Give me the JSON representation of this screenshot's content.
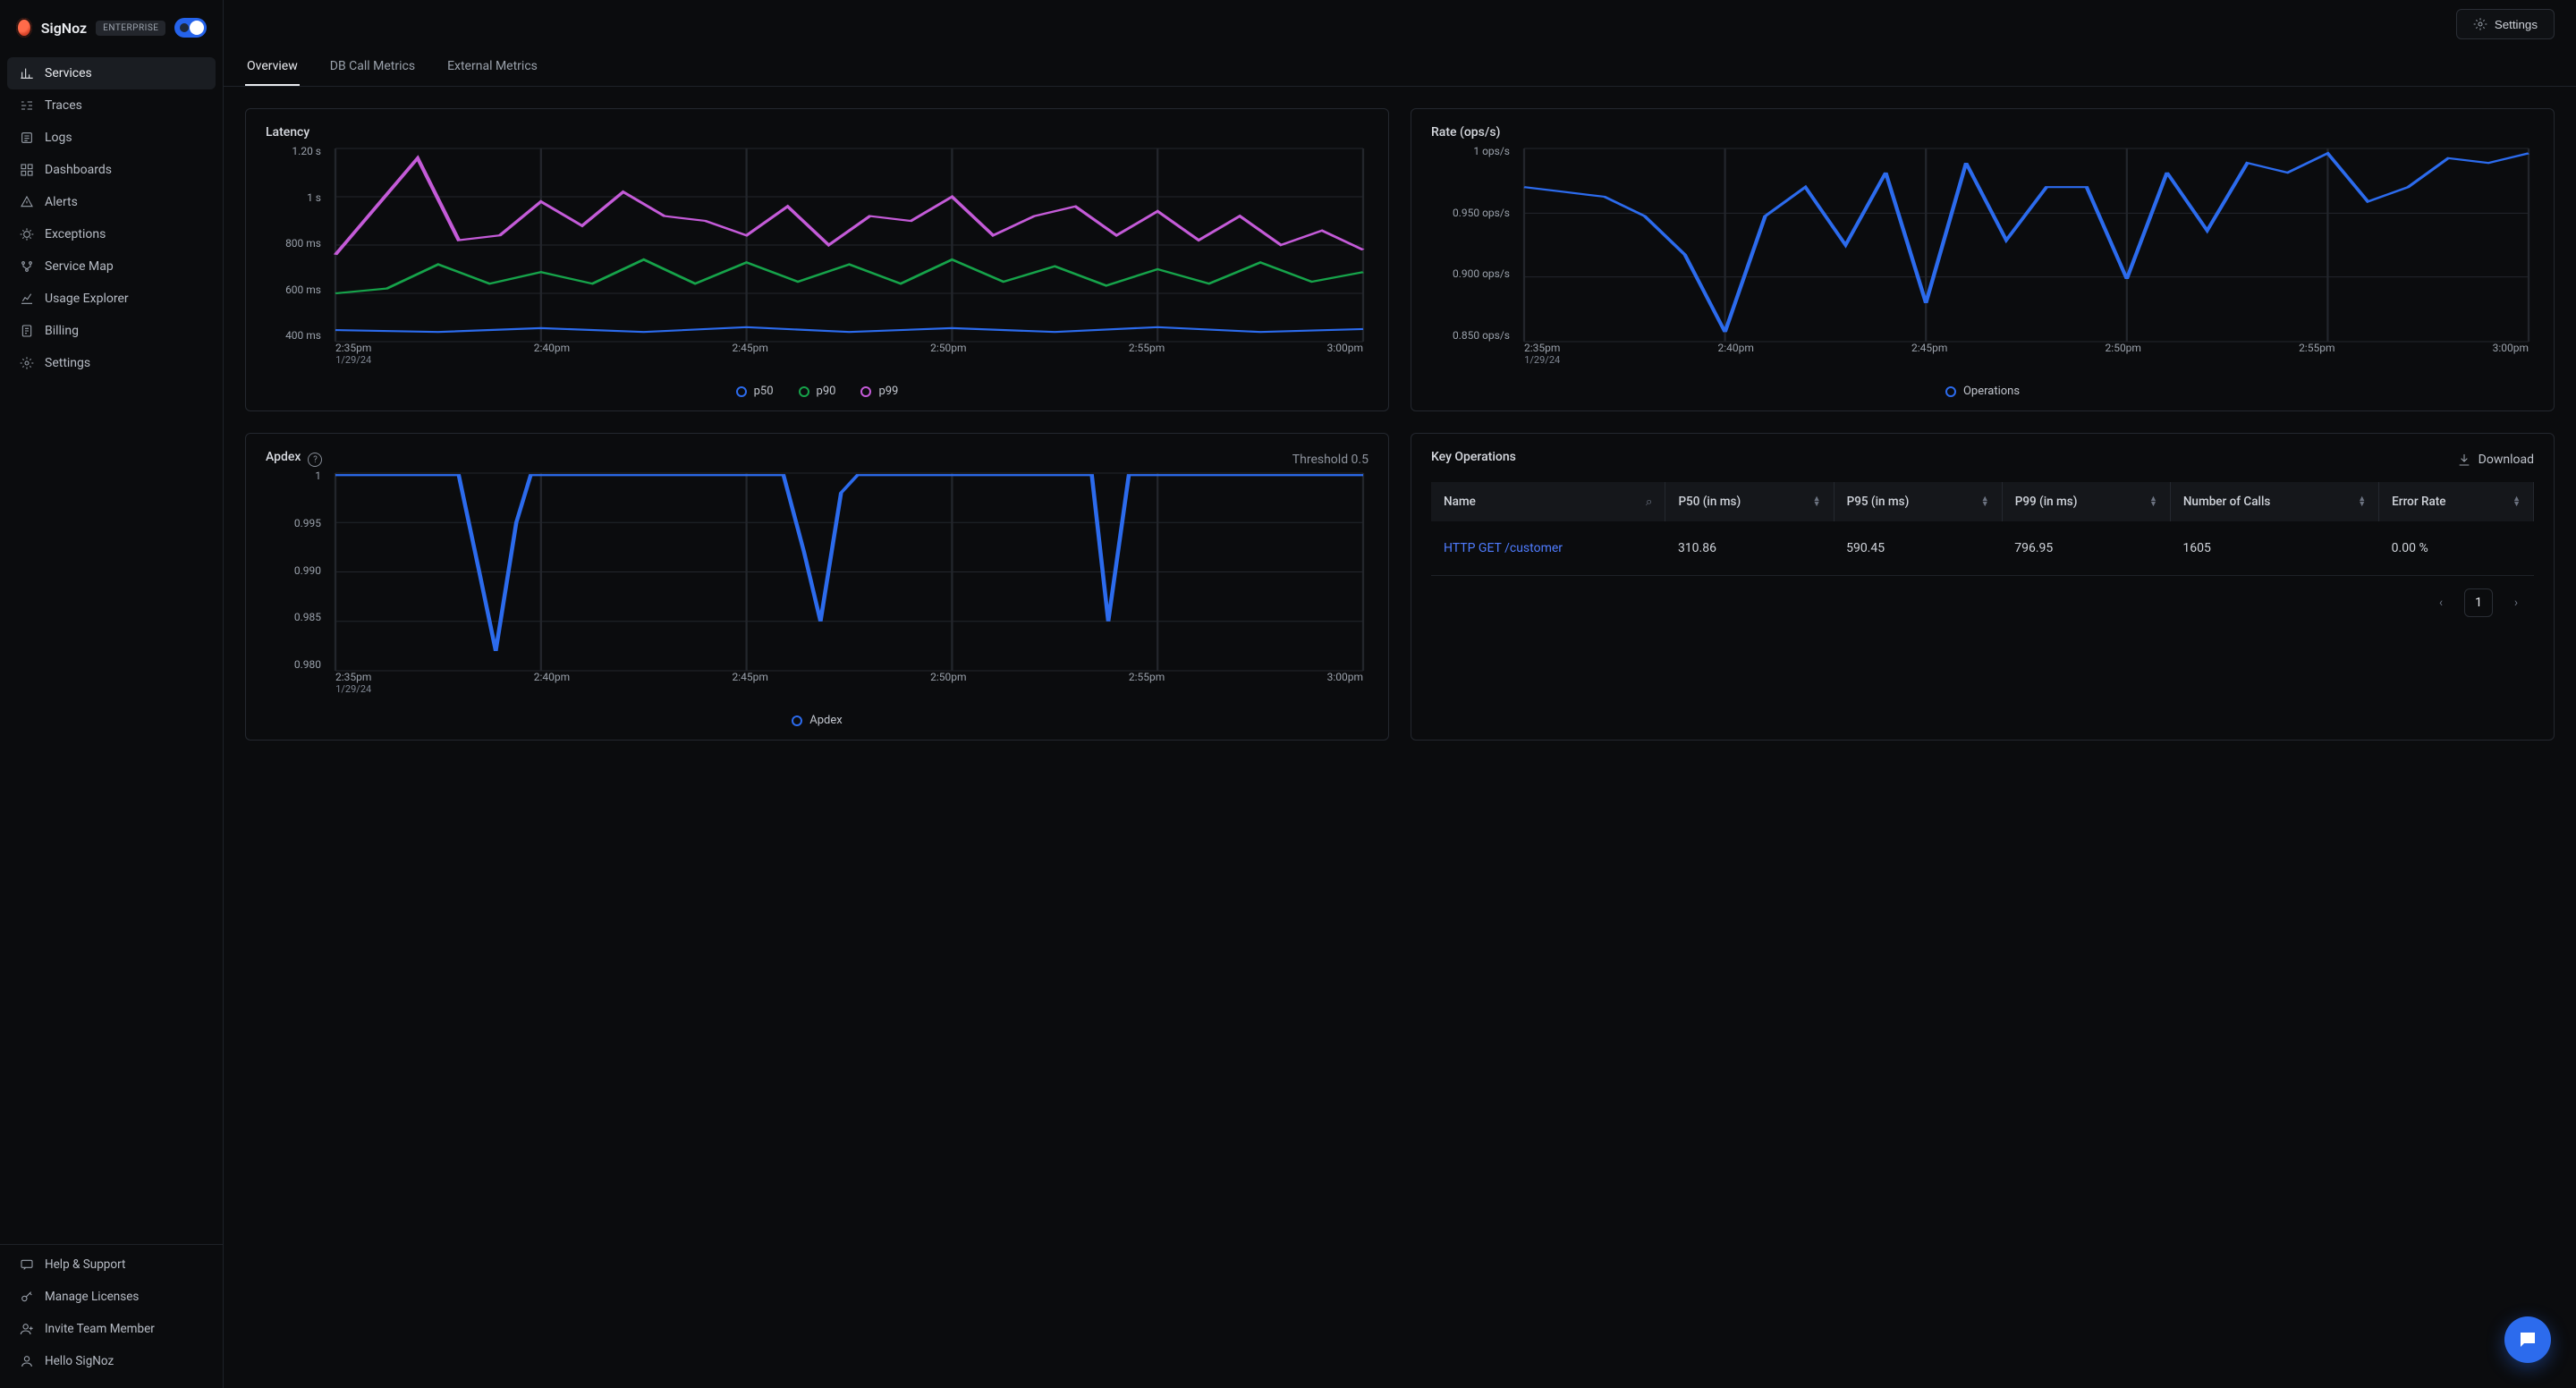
{
  "brand": {
    "name": "SigNoz",
    "tier": "ENTERPRISE"
  },
  "sidebar": {
    "items": [
      {
        "label": "Services"
      },
      {
        "label": "Traces"
      },
      {
        "label": "Logs"
      },
      {
        "label": "Dashboards"
      },
      {
        "label": "Alerts"
      },
      {
        "label": "Exceptions"
      },
      {
        "label": "Service Map"
      },
      {
        "label": "Usage Explorer"
      },
      {
        "label": "Billing"
      },
      {
        "label": "Settings"
      }
    ],
    "footer": [
      {
        "label": "Help & Support"
      },
      {
        "label": "Manage Licenses"
      },
      {
        "label": "Invite Team Member"
      },
      {
        "label": "Hello SigNoz"
      }
    ]
  },
  "topbar": {
    "settings": "Settings"
  },
  "tabs": [
    {
      "label": "Overview"
    },
    {
      "label": "DB Call Metrics"
    },
    {
      "label": "External Metrics"
    }
  ],
  "latency": {
    "title": "Latency",
    "y_ticks": [
      "1.20 s",
      "1 s",
      "800 ms",
      "600 ms",
      "400 ms"
    ],
    "x_ticks": [
      "2:35pm",
      "2:40pm",
      "2:45pm",
      "2:50pm",
      "2:55pm",
      "3:00pm"
    ],
    "x_sub": "1/29/24",
    "legend": [
      "p50",
      "p90",
      "p99"
    ]
  },
  "rate": {
    "title": "Rate (ops/s)",
    "y_ticks": [
      "1 ops/s",
      "0.950 ops/s",
      "0.900 ops/s",
      "0.850 ops/s"
    ],
    "x_ticks": [
      "2:35pm",
      "2:40pm",
      "2:45pm",
      "2:50pm",
      "2:55pm",
      "3:00pm"
    ],
    "x_sub": "1/29/24",
    "legend": [
      "Operations"
    ]
  },
  "apdex": {
    "title": "Apdex",
    "threshold_label": "Threshold 0.5",
    "y_ticks": [
      "1",
      "0.995",
      "0.990",
      "0.985",
      "0.980"
    ],
    "x_ticks": [
      "2:35pm",
      "2:40pm",
      "2:45pm",
      "2:50pm",
      "2:55pm",
      "3:00pm"
    ],
    "x_sub": "1/29/24",
    "legend": [
      "Apdex"
    ]
  },
  "key_ops": {
    "title": "Key Operations",
    "download": "Download",
    "columns": [
      "Name",
      "P50 (in ms)",
      "P95 (in ms)",
      "P99 (in ms)",
      "Number of Calls",
      "Error Rate"
    ],
    "rows": [
      {
        "name": "HTTP GET /customer",
        "p50": "310.86",
        "p95": "590.45",
        "p99": "796.95",
        "calls": "1605",
        "err": "0.00 %"
      }
    ],
    "page": "1"
  },
  "colors": {
    "p50": "#2c6bed",
    "p90": "#16a34a",
    "p99": "#c45bd8",
    "ops": "#2c6bed",
    "apdex": "#2c6bed"
  },
  "chart_data": [
    {
      "type": "line",
      "title": "Latency",
      "xlabel": "",
      "ylabel": "",
      "x": [
        "2:35pm",
        "2:40pm",
        "2:45pm",
        "2:50pm",
        "2:55pm",
        "3:00pm"
      ],
      "ylim_ms": [
        400,
        1200
      ],
      "series": [
        {
          "name": "p50",
          "color": "#2c6bed",
          "values_ms": [
            440,
            430,
            440,
            435,
            440,
            430,
            445,
            440,
            435,
            440,
            445,
            440
          ]
        },
        {
          "name": "p90",
          "color": "#16a34a",
          "values_ms": [
            600,
            620,
            720,
            640,
            700,
            660,
            740,
            680,
            700,
            720,
            680,
            700
          ]
        },
        {
          "name": "p99",
          "color": "#c45bd8",
          "values_ms": [
            780,
            980,
            1180,
            820,
            840,
            960,
            900,
            980,
            850,
            1000,
            920,
            820
          ]
        }
      ]
    },
    {
      "type": "line",
      "title": "Rate (ops/s)",
      "x": [
        "2:35pm",
        "2:40pm",
        "2:45pm",
        "2:50pm",
        "2:55pm",
        "3:00pm"
      ],
      "ylim": [
        0.85,
        1.0
      ],
      "series": [
        {
          "name": "Operations",
          "color": "#2c6bed",
          "values": [
            0.97,
            0.97,
            0.96,
            0.95,
            0.92,
            0.86,
            0.95,
            0.97,
            0.93,
            0.98,
            0.88,
            0.99,
            0.93,
            0.97,
            0.97,
            0.9,
            0.98,
            0.94,
            0.99,
            0.98,
            1.0,
            0.96,
            0.97,
            1.0
          ]
        }
      ]
    },
    {
      "type": "line",
      "title": "Apdex",
      "x": [
        "2:35pm",
        "2:40pm",
        "2:45pm",
        "2:50pm",
        "2:55pm",
        "3:00pm"
      ],
      "ylim": [
        0.98,
        1.0
      ],
      "series": [
        {
          "name": "Apdex",
          "color": "#2c6bed",
          "values": [
            1.0,
            1.0,
            1.0,
            0.99,
            0.982,
            0.995,
            1.0,
            1.0,
            1.0,
            1.0,
            1.0,
            0.992,
            0.985,
            0.998,
            1.0,
            1.0,
            1.0,
            1.0,
            0.985,
            1.0,
            1.0,
            1.0,
            1.0,
            1.0
          ]
        }
      ]
    }
  ]
}
